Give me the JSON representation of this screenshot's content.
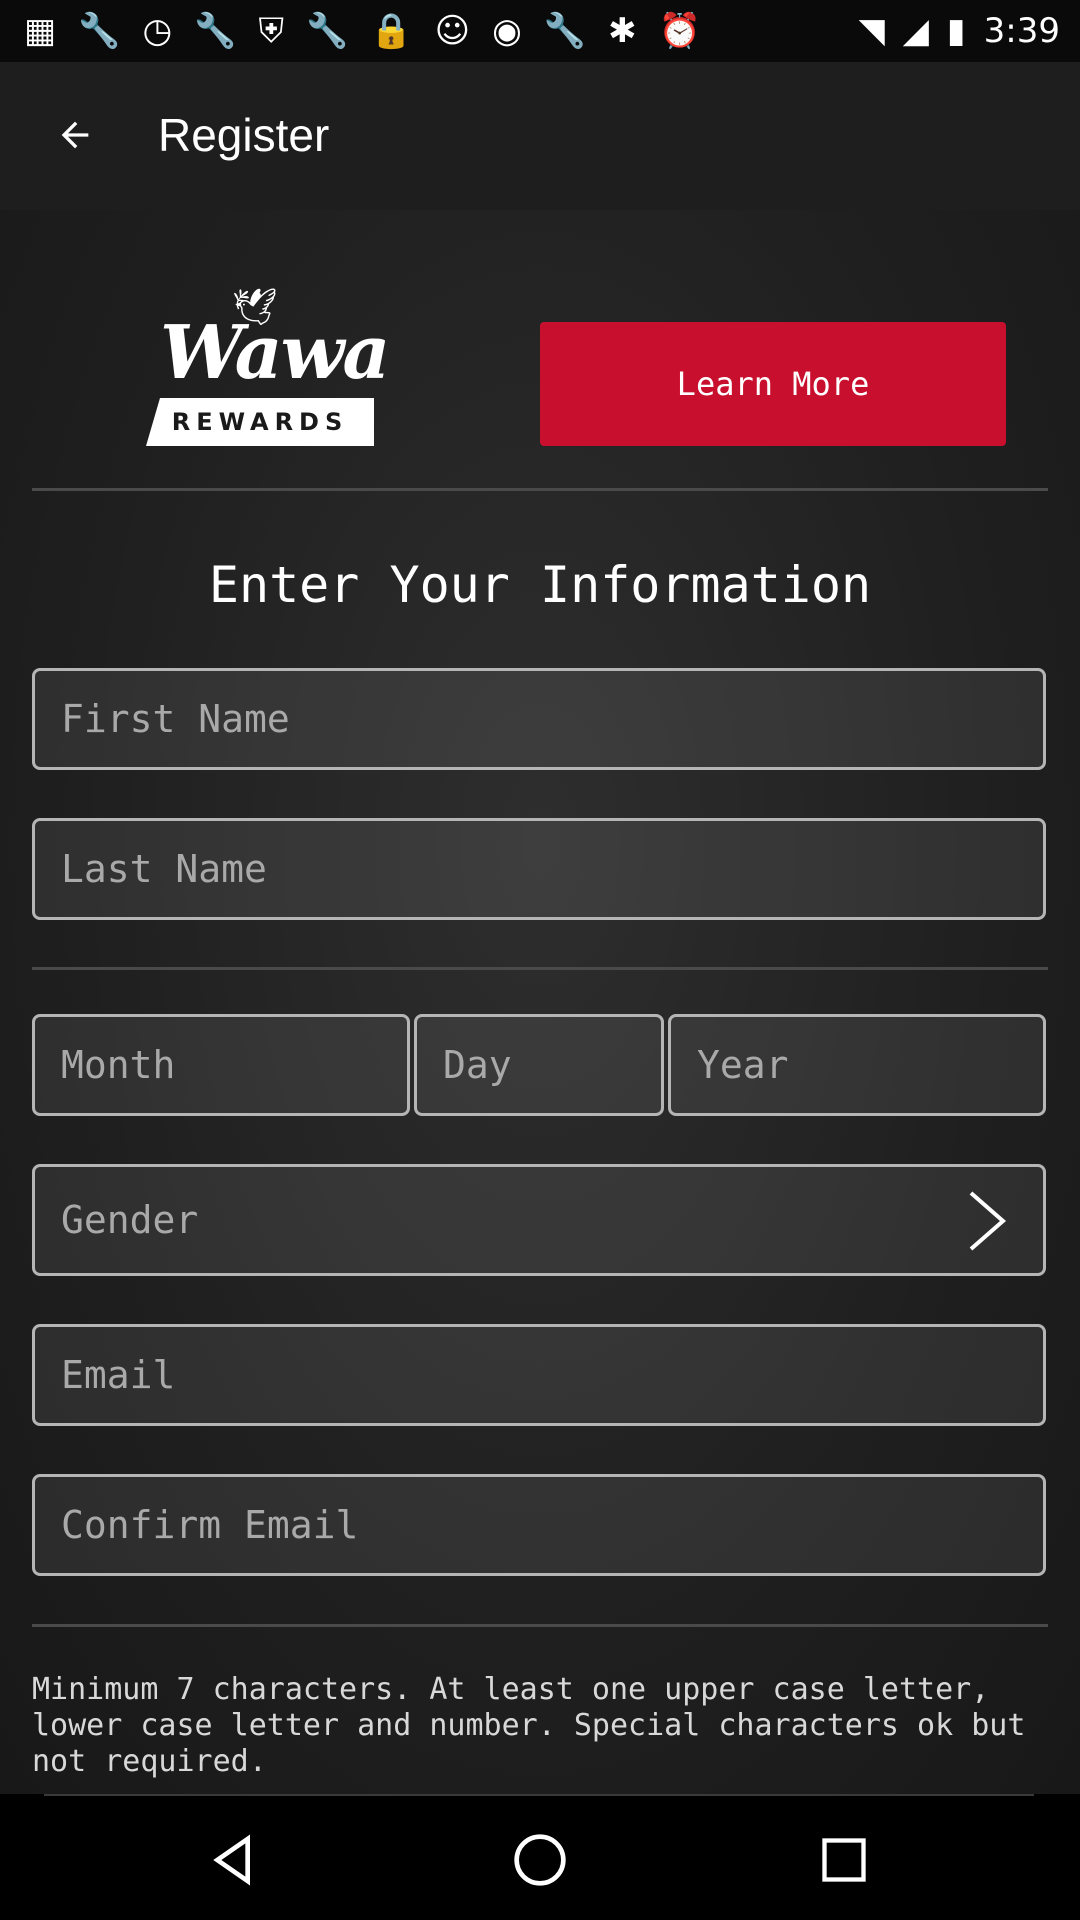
{
  "status_bar": {
    "time": "3:39",
    "left_icons": [
      "grid-icon",
      "wrench-icon",
      "timer-icon",
      "wrench-icon",
      "shield-icon",
      "wrench-icon",
      "lock-icon",
      "smiley-icon",
      "fox-sports-icon",
      "wrench-icon",
      "bluetooth-icon",
      "alarm-icon"
    ],
    "right_icons": [
      "wifi-icon",
      "signal-icon",
      "battery-icon"
    ]
  },
  "app_bar": {
    "title": "Register"
  },
  "brand": {
    "wordmark": "Wawa",
    "rewards_label": "REWARDS",
    "accent_color": "#c8102e"
  },
  "learn_more_button": {
    "label": "Learn More"
  },
  "form": {
    "title": "Enter Your Information",
    "first_name": {
      "placeholder": "First Name",
      "value": ""
    },
    "last_name": {
      "placeholder": "Last Name",
      "value": ""
    },
    "month": {
      "placeholder": "Month",
      "value": ""
    },
    "day": {
      "placeholder": "Day",
      "value": ""
    },
    "year": {
      "placeholder": "Year",
      "value": ""
    },
    "gender": {
      "placeholder": "Gender"
    },
    "email": {
      "placeholder": "Email",
      "value": ""
    },
    "confirm_email": {
      "placeholder": "Confirm Email",
      "value": ""
    },
    "password_note": "Minimum 7 characters. At least one upper case letter, lower case letter and number. Special characters ok but not required."
  },
  "nav_bar": {
    "buttons": [
      "back-triangle-icon",
      "home-circle-icon",
      "recents-square-icon"
    ]
  }
}
